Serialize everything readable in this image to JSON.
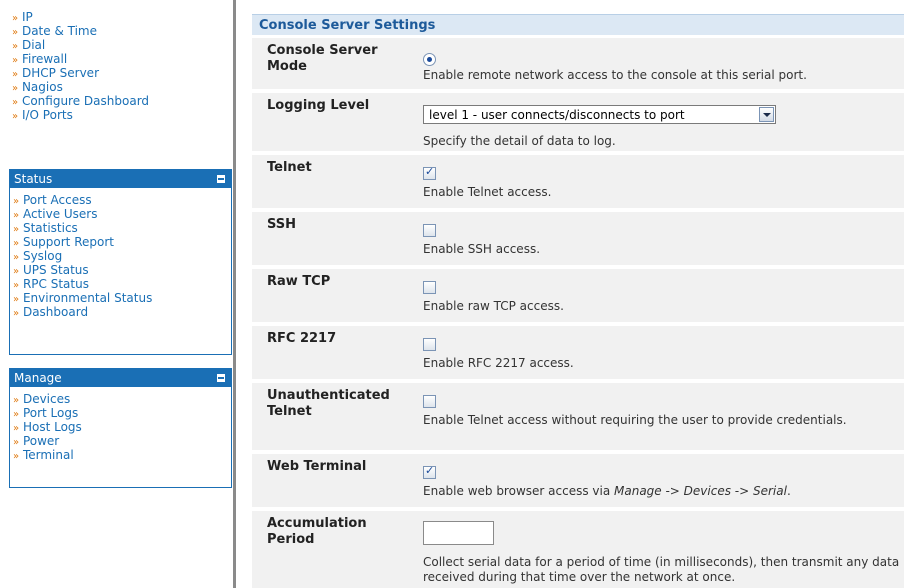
{
  "sidebar": {
    "top_links": [
      "IP",
      "Date & Time",
      "Dial",
      "Firewall",
      "DHCP Server",
      "Nagios",
      "Configure Dashboard",
      "I/O Ports"
    ],
    "status": {
      "title": "Status",
      "links": [
        "Port Access",
        "Active Users",
        "Statistics",
        "Support Report",
        "Syslog",
        "UPS Status",
        "RPC Status",
        "Environmental Status",
        "Dashboard"
      ]
    },
    "manage": {
      "title": "Manage",
      "links": [
        "Devices",
        "Port Logs",
        "Host Logs",
        "Power",
        "Terminal"
      ]
    }
  },
  "main": {
    "section_title": "Console Server Settings",
    "console_server_mode": {
      "label": "Console Server Mode",
      "help": "Enable remote network access to the console at this serial port.",
      "selected": true
    },
    "logging_level": {
      "label": "Logging Level",
      "value": "level 1 - user connects/disconnects to port",
      "help": "Specify the detail of data to log."
    },
    "telnet": {
      "label": "Telnet",
      "help": "Enable Telnet access.",
      "checked": true
    },
    "ssh": {
      "label": "SSH",
      "help": "Enable SSH access.",
      "checked": false
    },
    "raw_tcp": {
      "label": "Raw TCP",
      "help": "Enable raw TCP access.",
      "checked": false
    },
    "rfc2217": {
      "label": "RFC 2217",
      "help": "Enable RFC 2217 access.",
      "checked": false
    },
    "unauth_telnet": {
      "label": "Unauthenticated Telnet",
      "help": "Enable Telnet access without requiring the user to provide credentials.",
      "checked": false
    },
    "web_terminal": {
      "label": "Web Terminal",
      "help_prefix": "Enable web browser access via ",
      "help_path": "Manage -> Devices -> Serial",
      "help_suffix": ".",
      "checked": true
    },
    "accumulation_period": {
      "label": "Accumulation Period",
      "value": "",
      "help": "Collect serial data for a period of time (in milliseconds), then transmit any data received during that time over the network at once."
    }
  }
}
